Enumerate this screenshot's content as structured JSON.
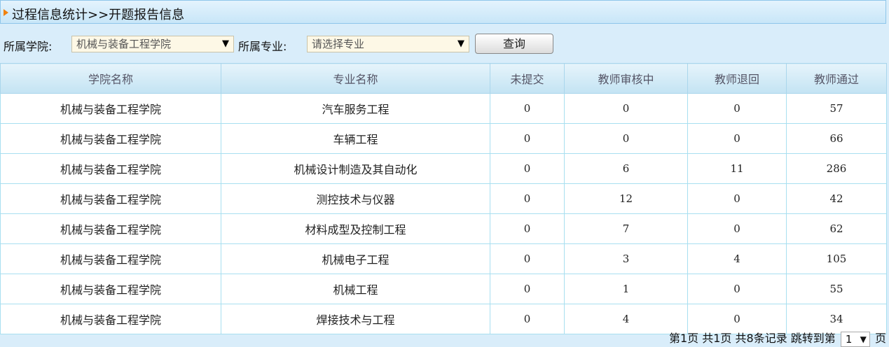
{
  "header": {
    "title": "过程信息统计>>开题报告信息"
  },
  "filters": {
    "college_label": "所属学院:",
    "college_value": "机械与装备工程学院",
    "major_label": "所属专业:",
    "major_value": "请选择专业",
    "query_label": "查询"
  },
  "table": {
    "columns": [
      "学院名称",
      "专业名称",
      "未提交",
      "教师审核中",
      "教师退回",
      "教师通过"
    ],
    "rows": [
      [
        "机械与装备工程学院",
        "汽车服务工程",
        "0",
        "0",
        "0",
        "57"
      ],
      [
        "机械与装备工程学院",
        "车辆工程",
        "0",
        "0",
        "0",
        "66"
      ],
      [
        "机械与装备工程学院",
        "机械设计制造及其自动化",
        "0",
        "6",
        "11",
        "286"
      ],
      [
        "机械与装备工程学院",
        "测控技术与仪器",
        "0",
        "12",
        "0",
        "42"
      ],
      [
        "机械与装备工程学院",
        "材料成型及控制工程",
        "0",
        "7",
        "0",
        "62"
      ],
      [
        "机械与装备工程学院",
        "机械电子工程",
        "0",
        "3",
        "4",
        "105"
      ],
      [
        "机械与装备工程学院",
        "机械工程",
        "0",
        "1",
        "0",
        "55"
      ],
      [
        "机械与装备工程学院",
        "焊接技术与工程",
        "0",
        "4",
        "0",
        "34"
      ]
    ]
  },
  "pagination": {
    "summary": "第1页 共1页 共8条记录 跳转到第",
    "page_value": "1",
    "suffix": "页"
  }
}
